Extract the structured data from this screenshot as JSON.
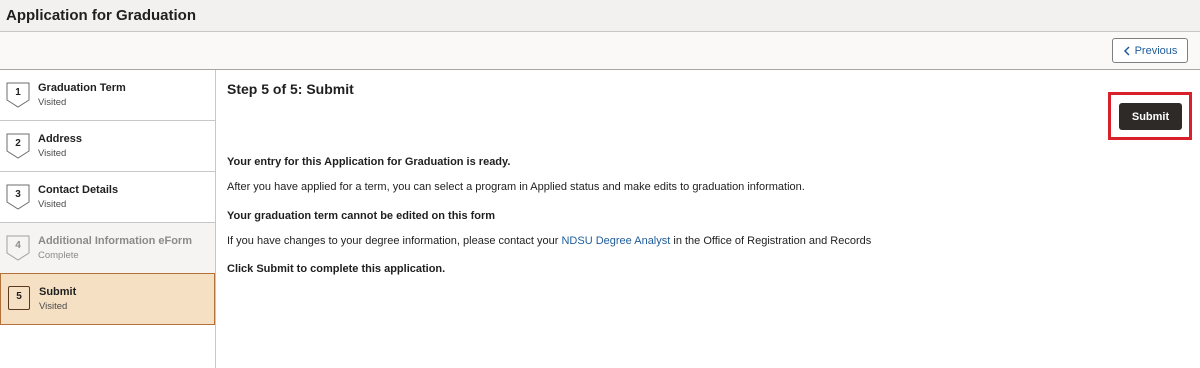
{
  "page": {
    "title": "Application for Graduation"
  },
  "toolbar": {
    "previous_label": "Previous",
    "previous_icon": "chevron-left-icon"
  },
  "steps": [
    {
      "number": "1",
      "name": "Graduation Term",
      "status": "Visited"
    },
    {
      "number": "2",
      "name": "Address",
      "status": "Visited"
    },
    {
      "number": "3",
      "name": "Contact Details",
      "status": "Visited"
    },
    {
      "number": "4",
      "name": "Additional Information eForm",
      "status": "Complete"
    },
    {
      "number": "5",
      "name": "Submit",
      "status": "Visited"
    }
  ],
  "main": {
    "heading": "Step 5 of 5: Submit",
    "submit_label": "Submit",
    "ready_text": "Your entry for this Application for Graduation is ready.",
    "applied_text": "After you have applied for a term, you can select a program in Applied status and make edits to graduation information.",
    "term_note": "Your graduation term cannot be edited on this form",
    "changes_prefix": "If you have changes to your degree information, please contact your ",
    "changes_link": "NDSU Degree Analyst",
    "changes_suffix": " in the Office of Registration and Records",
    "click_submit_text": "Click Submit to complete this application."
  },
  "colors": {
    "active_step_bg": "#f5e0c4",
    "active_step_border": "#b5713a",
    "submit_bg": "#2d2a27",
    "highlight_border": "#d81f2a",
    "link": "#1f5c99"
  }
}
